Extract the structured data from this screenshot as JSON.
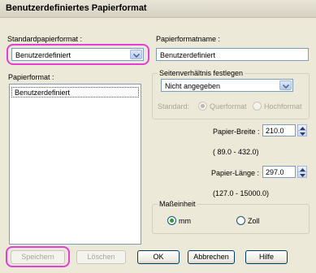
{
  "window": {
    "title": "Benutzerdefiniertes Papierformat"
  },
  "standard_paper": {
    "label": "Standardpapierformat :",
    "selected": "Benutzerdefiniert"
  },
  "paper_name": {
    "label": "Papierformatname :",
    "value": "Benutzerdefiniert"
  },
  "paper_format": {
    "label": "Papierformat :",
    "items": [
      "Benutzerdefiniert"
    ]
  },
  "aspect_ratio": {
    "group_title": "Seitenverhältnis festlegen",
    "selected": "Nicht angegeben",
    "standard_label": "Standard:",
    "landscape_label": "Querformat",
    "portrait_label": "Hochformat"
  },
  "width": {
    "label": "Papier-Breite :",
    "value": "210.0",
    "range": "( 89.0 - 432.0)"
  },
  "length": {
    "label": "Papier-Länge :",
    "value": "297.0",
    "range": "(127.0 - 15000.0)"
  },
  "unit": {
    "group_title": "Maßeinheit",
    "mm_label": "mm",
    "inch_label": "Zoll",
    "selected": "mm"
  },
  "buttons": {
    "save": "Speichern",
    "delete": "Löschen",
    "ok": "OK",
    "cancel": "Abbrechen",
    "help": "Hilfe"
  },
  "colors": {
    "highlight": "#e33fd4",
    "panel": "#ece9d8",
    "selection": "#316ac5"
  },
  "icons": {
    "dropdown": "chevron-down-icon",
    "spin_up": "spin-up-icon",
    "spin_down": "spin-down-icon"
  }
}
